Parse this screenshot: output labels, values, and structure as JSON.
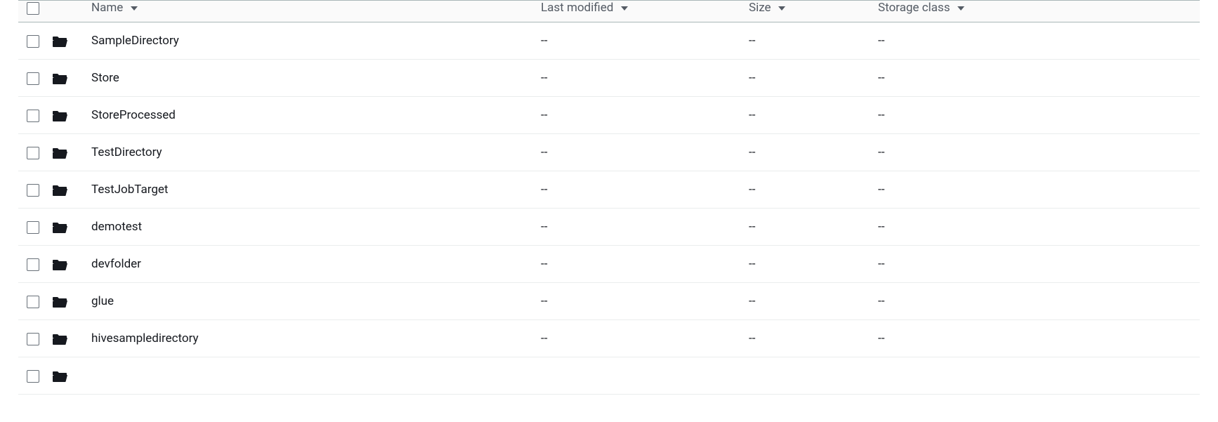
{
  "columns": {
    "name": "Name",
    "last_modified": "Last modified",
    "size": "Size",
    "storage_class": "Storage class"
  },
  "placeholder": "--",
  "rows": [
    {
      "name": "SampleDirectory",
      "last_modified": "--",
      "size": "--",
      "storage_class": "--"
    },
    {
      "name": "Store",
      "last_modified": "--",
      "size": "--",
      "storage_class": "--"
    },
    {
      "name": "StoreProcessed",
      "last_modified": "--",
      "size": "--",
      "storage_class": "--"
    },
    {
      "name": "TestDirectory",
      "last_modified": "--",
      "size": "--",
      "storage_class": "--"
    },
    {
      "name": "TestJobTarget",
      "last_modified": "--",
      "size": "--",
      "storage_class": "--"
    },
    {
      "name": "demotest",
      "last_modified": "--",
      "size": "--",
      "storage_class": "--"
    },
    {
      "name": "devfolder",
      "last_modified": "--",
      "size": "--",
      "storage_class": "--"
    },
    {
      "name": "glue",
      "last_modified": "--",
      "size": "--",
      "storage_class": "--"
    },
    {
      "name": "hivesampledirectory",
      "last_modified": "--",
      "size": "--",
      "storage_class": "--"
    }
  ]
}
